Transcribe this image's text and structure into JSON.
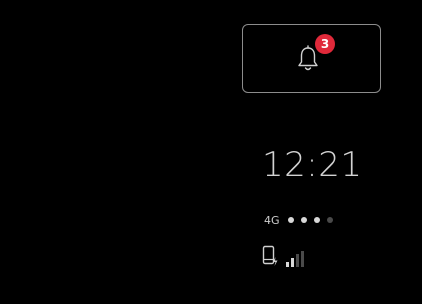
{
  "notification": {
    "count": "3",
    "badge_color": "#e0293a",
    "icon": "bell-icon"
  },
  "status": {
    "time": "12:21",
    "network_type": "4G",
    "dots_total": 4,
    "dots_active": 3,
    "signal_bars_total": 4,
    "signal_bars_active": 2,
    "device_icon": "phone-charging-icon",
    "signal_icon": "signal-strength-icon"
  },
  "colors": {
    "background": "#000000",
    "text": "#d2d2d2",
    "active": "#d8d8d8",
    "inactive": "#4a4a4a"
  }
}
